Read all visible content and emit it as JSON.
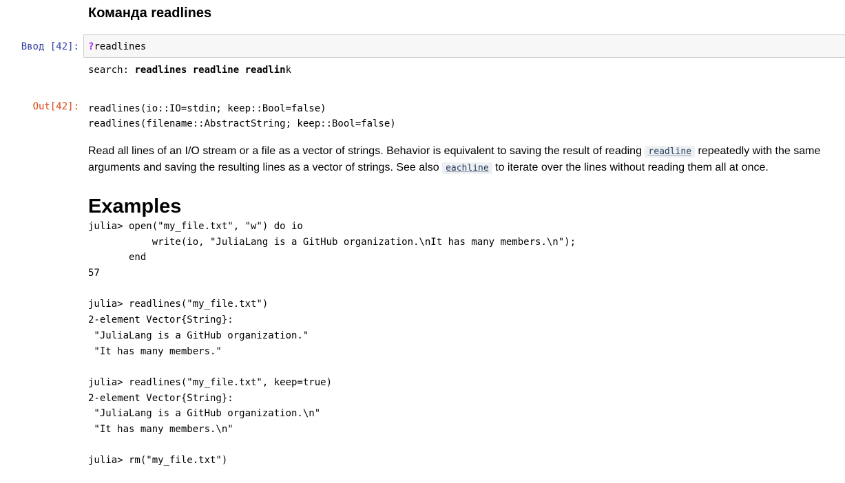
{
  "heading": "Команда readlines",
  "input": {
    "prompt": "Ввод [42]:",
    "question_mark": "?",
    "code": "readlines"
  },
  "search": {
    "label": "search: ",
    "bold_text": "readlines readline readlin",
    "tail": "k"
  },
  "output": {
    "prompt": "Out[42]:",
    "signatures": [
      "readlines(io::IO=stdin; keep::Bool=false)",
      "readlines(filename::AbstractString; keep::Bool=false)"
    ],
    "description": {
      "part1": "Read all lines of an I/O stream or a file as a vector of strings. Behavior is equivalent to saving the result of reading ",
      "code1": "readline",
      "part2": " repeatedly with the same arguments and saving the resulting lines as a vector of strings. See also ",
      "code2": "eachline",
      "part3": " to iterate over the lines without reading them all at once."
    },
    "examples_heading": "Examples",
    "examples_lines": [
      "julia> open(\"my_file.txt\", \"w\") do io",
      "           write(io, \"JuliaLang is a GitHub organization.\\nIt has many members.\\n\");",
      "       end",
      "57",
      "",
      "julia> readlines(\"my_file.txt\")",
      "2-element Vector{String}:",
      " \"JuliaLang is a GitHub organization.\"",
      " \"It has many members.\"",
      "",
      "julia> readlines(\"my_file.txt\", keep=true)",
      "2-element Vector{String}:",
      " \"JuliaLang is a GitHub organization.\\n\"",
      " \"It has many members.\\n\"",
      "",
      "julia> rm(\"my_file.txt\")"
    ]
  }
}
